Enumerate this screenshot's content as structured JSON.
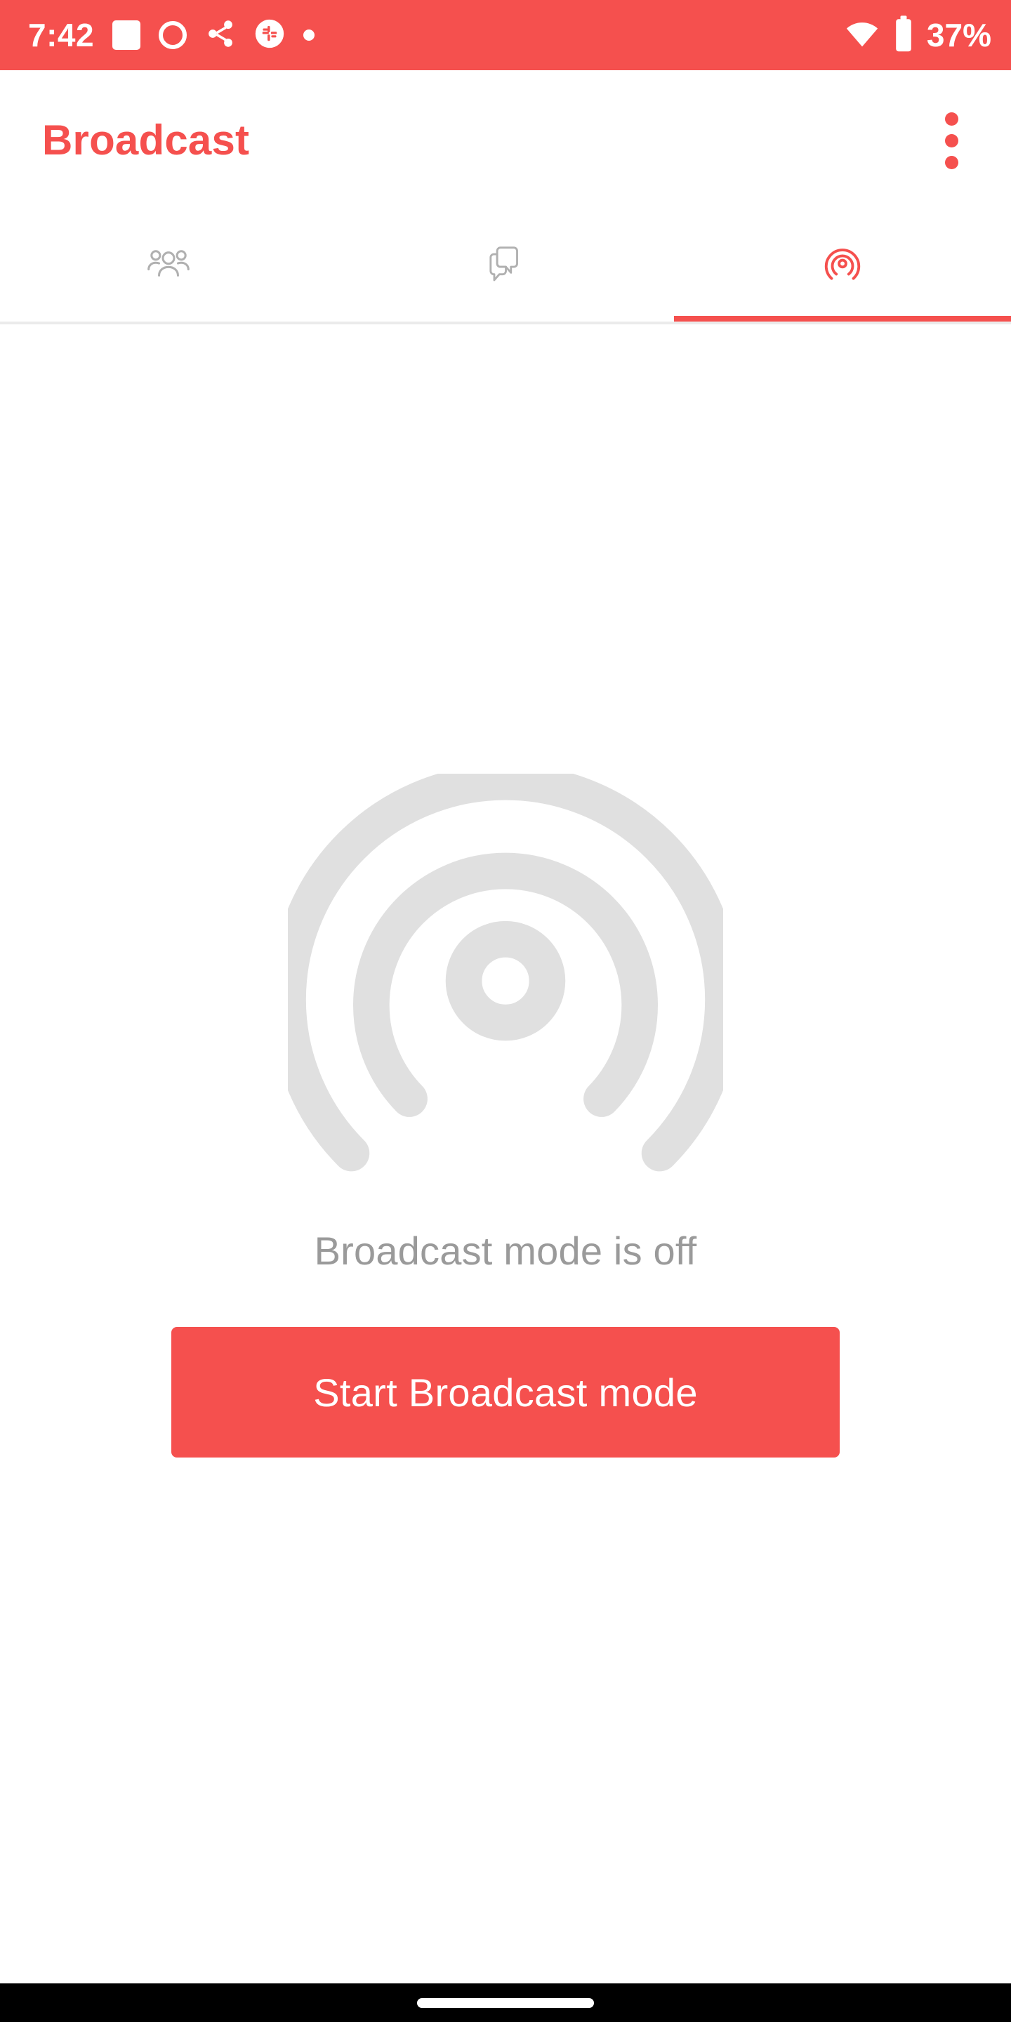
{
  "status_bar": {
    "time": "7:42",
    "battery_percent": "37%",
    "background_color": "#F5504E",
    "foreground_color": "#FFFFFF",
    "left_icons": [
      "rounded-square-notification-icon",
      "circle-outline-notification-icon",
      "share-notification-icon",
      "slack-notification-icon",
      "small-dot-notification-icon"
    ],
    "right_icons": [
      "wifi-icon",
      "battery-icon"
    ]
  },
  "app_bar": {
    "title": "Broadcast",
    "title_color": "#F5504E",
    "overflow_menu_label": "More options"
  },
  "tabs": {
    "active_index": 2,
    "indicator_color": "#F5504E",
    "inactive_color": "#B0B0B0",
    "items": [
      {
        "icon": "people-group-icon",
        "label": "People",
        "active": false
      },
      {
        "icon": "chat-bubbles-icon",
        "label": "Chats",
        "active": false
      },
      {
        "icon": "broadcast-radar-icon",
        "label": "Broadcast",
        "active": true
      }
    ]
  },
  "main": {
    "illustration": "broadcast-radar-illustration",
    "illustration_color": "#E0E0E0",
    "status_message": "Broadcast mode is off",
    "status_message_color": "#9A9A9A",
    "primary_button_label": "Start Broadcast mode",
    "primary_button_color": "#F5504E",
    "primary_button_text_color": "#FFFFFF"
  },
  "nav_bar": {
    "background_color": "#000000",
    "gesture_pill": "home-gesture-pill"
  }
}
